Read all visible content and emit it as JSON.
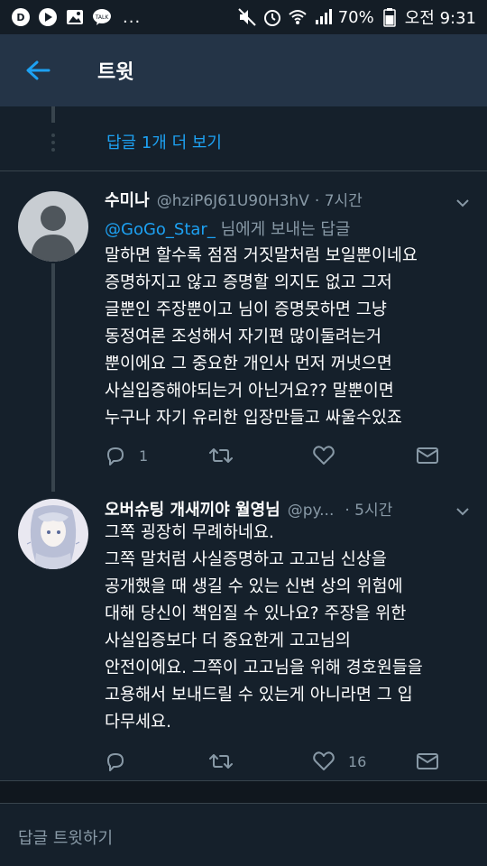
{
  "status_bar": {
    "battery": "70%",
    "time": "오전 9:31",
    "notification_icons": [
      "daum-icon",
      "play-icon",
      "image-icon",
      "talk-icon"
    ],
    "more": "..."
  },
  "header": {
    "title": "트윗"
  },
  "show_more": {
    "label": "답글 1개 더 보기"
  },
  "tweets": [
    {
      "name": "수미나",
      "handle": "@hziP6J61U90H3hV",
      "time": "· 7시간",
      "reply_to_mention": "@GoGo_Star_",
      "reply_to_suffix": " 님에게 보내는 답글",
      "lines": [
        "말하면 할수록 점점 거짓말처럼 보일뿐이네요",
        "증명하지고 않고 증명할 의지도 없고 그저",
        "글뿐인 주장뿐이고 님이 증명못하면 그냥",
        "동정여론 조성해서 자기편 많이둘려는거",
        "뿐이에요 그 중요한 개인사 먼저 꺼냇으면",
        "사실입증해야되는거 아닌거요?? 말뿐이면",
        "누구나 자기 유리한 입장만들고 싸울수있죠"
      ],
      "reply_count": "1",
      "retweet_count": "",
      "like_count": ""
    },
    {
      "name": "오버슈팅 개새끼야 월영님",
      "handle": "@py...",
      "time": "· 5시간",
      "lines": [
        "그쪽 굉장히 무례하네요.",
        "그쪽 말처럼 사실증명하고 고고님 신상을",
        "공개했을 때 생길 수 있는 신변 상의 위험에",
        "대해 당신이 책임질 수 있나요? 주장을 위한",
        "사실입증보다 더 중요한게 고고님의",
        "안전이에요. 그쪽이 고고님을 위해 경호원들을",
        "고용해서 보내드릴 수 있는게 아니라면 그 입",
        "다무세요."
      ],
      "reply_count": "",
      "retweet_count": "",
      "like_count": "16"
    }
  ],
  "compose": {
    "placeholder": "답글 트윗하기"
  },
  "colors": {
    "background": "#15202b",
    "header": "#243447",
    "accent": "#1da1f2",
    "secondary_text": "#8899a6",
    "divider": "#38444d"
  }
}
